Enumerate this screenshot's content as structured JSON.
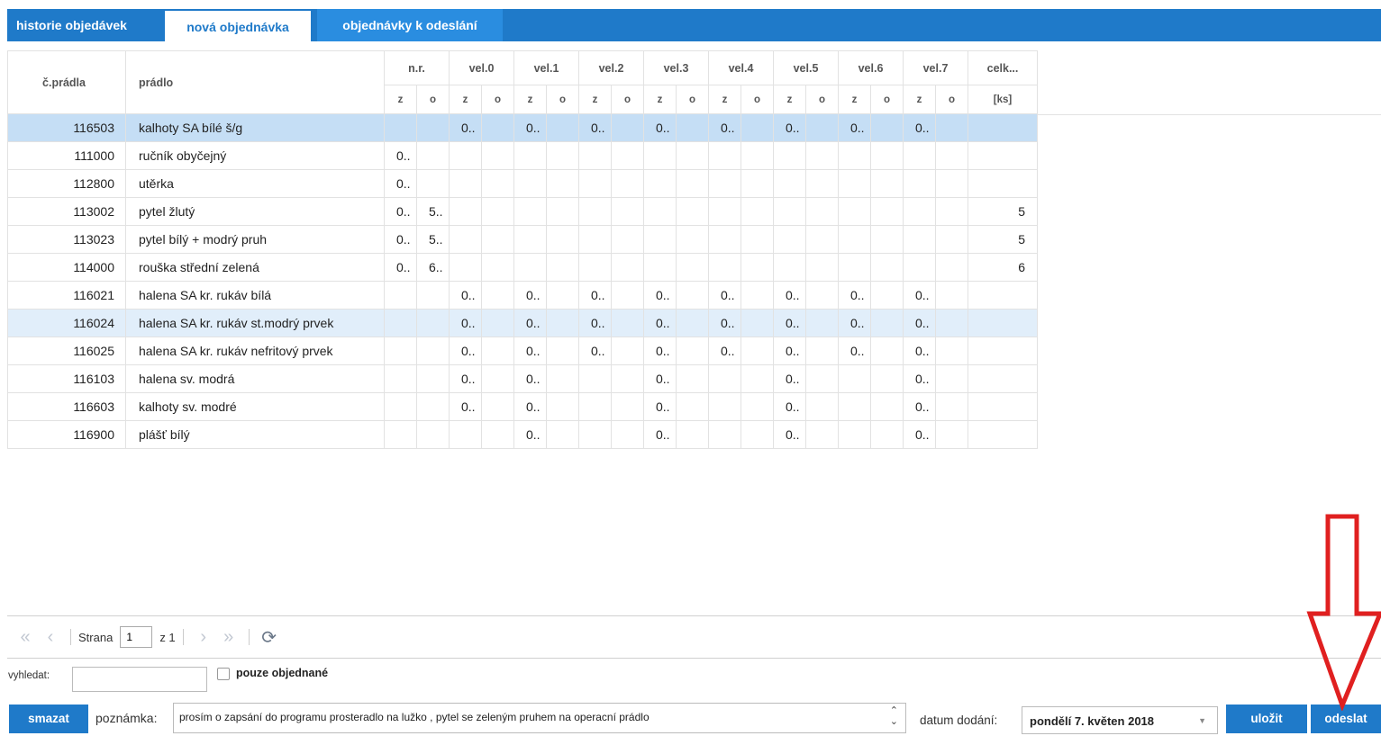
{
  "tabs": [
    {
      "label": "historie objedávek"
    },
    {
      "label": "nová objednávka"
    },
    {
      "label": "objednávky k odeslání"
    }
  ],
  "grid": {
    "header": {
      "code": "č.prádla",
      "name": "prádlo",
      "groups": [
        "n.r.",
        "vel.0",
        "vel.1",
        "vel.2",
        "vel.3",
        "vel.4",
        "vel.5",
        "vel.6",
        "vel.7"
      ],
      "total": "celk...",
      "sub_z": "z",
      "sub_o": "o",
      "total_unit": "[ks]"
    },
    "rows": [
      {
        "code": "116503",
        "name": "kalhoty SA bílé š/g",
        "cells": [
          "",
          "",
          "0..",
          "",
          "0..",
          "",
          "0..",
          "",
          "0..",
          "",
          "0..",
          "",
          "0..",
          "",
          "0..",
          "",
          "0..",
          ""
        ],
        "total": ""
      },
      {
        "code": "111000",
        "name": "ručník obyčejný",
        "cells": [
          "0..",
          "",
          "",
          "",
          "",
          "",
          "",
          "",
          "",
          "",
          "",
          "",
          "",
          "",
          "",
          "",
          "",
          ""
        ],
        "total": ""
      },
      {
        "code": "112800",
        "name": "utěrka",
        "cells": [
          "0..",
          "",
          "",
          "",
          "",
          "",
          "",
          "",
          "",
          "",
          "",
          "",
          "",
          "",
          "",
          "",
          "",
          ""
        ],
        "total": ""
      },
      {
        "code": "113002",
        "name": "pytel žlutý",
        "cells": [
          "0..",
          "5..",
          "",
          "",
          "",
          "",
          "",
          "",
          "",
          "",
          "",
          "",
          "",
          "",
          "",
          "",
          "",
          ""
        ],
        "total": "5"
      },
      {
        "code": "113023",
        "name": "pytel bílý + modrý pruh",
        "cells": [
          "0..",
          "5..",
          "",
          "",
          "",
          "",
          "",
          "",
          "",
          "",
          "",
          "",
          "",
          "",
          "",
          "",
          "",
          ""
        ],
        "total": "5"
      },
      {
        "code": "114000",
        "name": "rouška střední zelená",
        "cells": [
          "0..",
          "6..",
          "",
          "",
          "",
          "",
          "",
          "",
          "",
          "",
          "",
          "",
          "",
          "",
          "",
          "",
          "",
          ""
        ],
        "total": "6"
      },
      {
        "code": "116021",
        "name": "halena SA kr. rukáv bílá",
        "cells": [
          "",
          "",
          "0..",
          "",
          "0..",
          "",
          "0..",
          "",
          "0..",
          "",
          "0..",
          "",
          "0..",
          "",
          "0..",
          "",
          "0..",
          ""
        ],
        "total": ""
      },
      {
        "code": "116024",
        "name": "halena SA kr. rukáv st.modrý prvek",
        "cells": [
          "",
          "",
          "0..",
          "",
          "0..",
          "",
          "0..",
          "",
          "0..",
          "",
          "0..",
          "",
          "0..",
          "",
          "0..",
          "",
          "0..",
          ""
        ],
        "total": ""
      },
      {
        "code": "116025",
        "name": "halena SA kr. rukáv nefritový prvek",
        "cells": [
          "",
          "",
          "0..",
          "",
          "0..",
          "",
          "0..",
          "",
          "0..",
          "",
          "0..",
          "",
          "0..",
          "",
          "0..",
          "",
          "0..",
          ""
        ],
        "total": ""
      },
      {
        "code": "116103",
        "name": "halena sv. modrá",
        "cells": [
          "",
          "",
          "0..",
          "",
          "0..",
          "",
          "",
          "",
          "0..",
          "",
          "",
          "",
          "0..",
          "",
          "",
          "",
          "0..",
          ""
        ],
        "total": ""
      },
      {
        "code": "116603",
        "name": "kalhoty sv. modré",
        "cells": [
          "",
          "",
          "0..",
          "",
          "0..",
          "",
          "",
          "",
          "0..",
          "",
          "",
          "",
          "0..",
          "",
          "",
          "",
          "0..",
          ""
        ],
        "total": ""
      },
      {
        "code": "116900",
        "name": "plášť bílý",
        "cells": [
          "",
          "",
          "",
          "",
          "0..",
          "",
          "",
          "",
          "0..",
          "",
          "",
          "",
          "0..",
          "",
          "",
          "",
          "0..",
          ""
        ],
        "total": ""
      }
    ]
  },
  "pager": {
    "page_label": "Strana",
    "page_value": "1",
    "of_label": "z 1"
  },
  "search": {
    "label": "vyhledat:",
    "value": "",
    "only_ordered_label": "pouze objednané"
  },
  "bottom": {
    "delete_label": "smazat",
    "note_label": "poznámka:",
    "note_value": "prosím o  zapsání do programu prosteradlo na lužko , pytel se zeleným pruhem na operacní prádlo",
    "date_label": "datum dodání:",
    "date_value": "pondělí 7. květen 2018",
    "save_label": "uložit",
    "send_label": "odeslat"
  },
  "colors": {
    "accent": "#1f7ac9",
    "selected_row": "#c5def5",
    "annotation_arrow": "#e02020"
  },
  "icons": {
    "first": "first-page-icon",
    "prev": "prev-page-icon",
    "next": "next-page-icon",
    "last": "last-page-icon",
    "refresh": "refresh-icon",
    "annotation": "red-arrow-down-icon"
  }
}
